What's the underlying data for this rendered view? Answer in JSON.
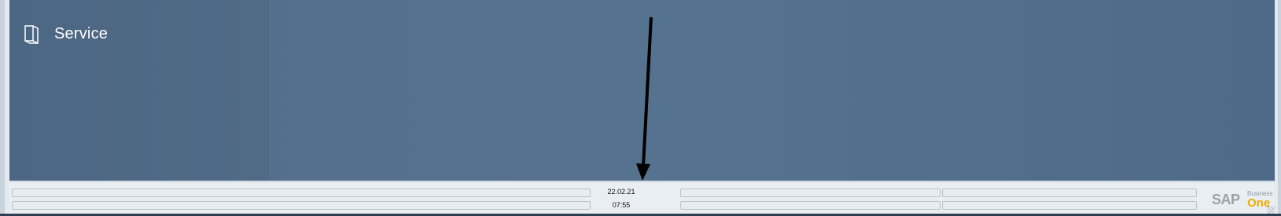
{
  "module": {
    "title": "Service",
    "icon": "book-icon"
  },
  "statusbar": {
    "date": "22.02.21",
    "time": "07:55"
  },
  "branding": {
    "sap": "SAP",
    "business": "Business",
    "one": "One"
  },
  "colors": {
    "background": "#52708d",
    "statusbar": "#e9eef2",
    "one_accent": "#f0ab00"
  }
}
